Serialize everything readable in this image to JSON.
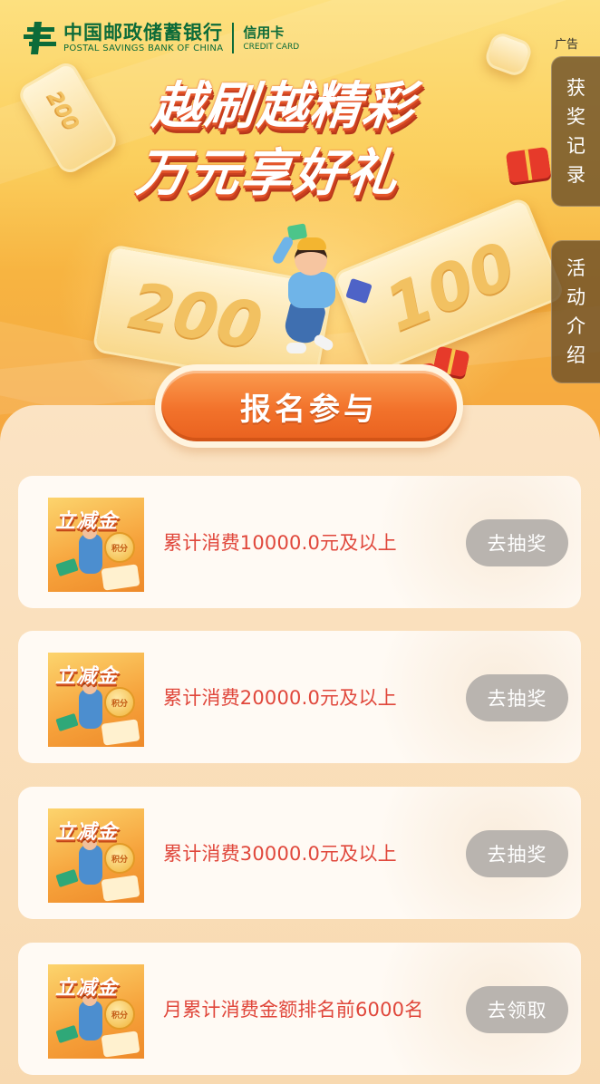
{
  "header": {
    "bank_name_cn": "中国邮政储蓄银行",
    "bank_name_en": "POSTAL SAVINGS BANK OF CHINA",
    "card_cn": "信用卡",
    "card_en": "CREDIT CARD",
    "ad_label": "广告"
  },
  "banner": {
    "title_line1": "越刷越精彩",
    "title_line2": "万元享好礼",
    "ticket_left": "200",
    "ticket_mid": "200",
    "ticket_right": "100"
  },
  "side_tabs": [
    {
      "label": [
        "获",
        "奖",
        "记",
        "录"
      ]
    },
    {
      "label": [
        "活",
        "动",
        "介",
        "绍"
      ]
    }
  ],
  "join_button": {
    "label": "报名参与"
  },
  "tasks": [
    {
      "thumb_title": "立减金",
      "thumb_coin": "积分",
      "text": "累计消费10000.0元及以上",
      "button": "去抽奖"
    },
    {
      "thumb_title": "立减金",
      "thumb_coin": "积分",
      "text": "累计消费20000.0元及以上",
      "button": "去抽奖"
    },
    {
      "thumb_title": "立减金",
      "thumb_coin": "积分",
      "text": "累计消费30000.0元及以上",
      "button": "去抽奖"
    },
    {
      "thumb_title": "立减金",
      "thumb_coin": "积分",
      "text": "月累计消费金额排名前6000名",
      "button": "去领取"
    }
  ],
  "colors": {
    "brand_green": "#0c6b39",
    "task_text_red": "#e0473b",
    "disabled_button_gray": "#b9b4af",
    "join_button_orange": "#f2722b"
  },
  "icons": {
    "bank_logo": "postal-logo-icon",
    "gift": "gift-box-icon"
  }
}
